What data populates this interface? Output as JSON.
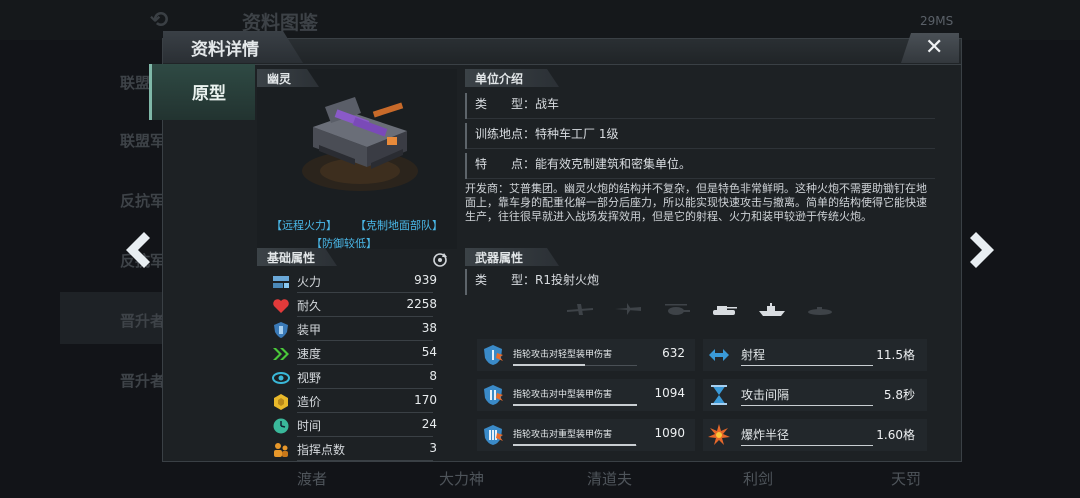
{
  "background": {
    "title": "资料图鉴",
    "status": "29MS",
    "sidebar": [
      "联盟",
      "联盟军",
      "反抗军",
      "反抗军",
      "晋升者",
      "晋升者"
    ],
    "bottom_tabs": [
      "渡者",
      "大力神",
      "清道夫",
      "利剑",
      "天罚"
    ]
  },
  "modal": {
    "title": "资料详情",
    "close_label": "✕",
    "left_tab": "原型"
  },
  "unit": {
    "name": "幽灵",
    "tags": [
      "【远程火力】",
      "【克制地面部队】",
      "【防御较低】"
    ]
  },
  "base_stats": {
    "heading": "基础属性",
    "rows": [
      {
        "label": "火力",
        "value": "939",
        "icon": "firepower-icon"
      },
      {
        "label": "耐久",
        "value": "2258",
        "icon": "heart-icon"
      },
      {
        "label": "装甲",
        "value": "38",
        "icon": "shield-icon"
      },
      {
        "label": "速度",
        "value": "54",
        "icon": "speed-icon"
      },
      {
        "label": "视野",
        "value": "8",
        "icon": "eye-icon"
      },
      {
        "label": "造价",
        "value": "170",
        "icon": "cost-icon"
      },
      {
        "label": "时间",
        "value": "24",
        "icon": "clock-icon"
      },
      {
        "label": "指挥点数",
        "value": "3",
        "icon": "command-icon"
      }
    ]
  },
  "unit_intro": {
    "heading": "单位介绍",
    "type_line": "类　　型：战车",
    "location_line": "训练地点：特种车工厂 1级",
    "feature_line": "特　　点：能有效克制建筑和密集单位。",
    "description": "开发商：艾普集团。幽灵火炮的结构并不复杂，但是特色非常鲜明。这种火炮不需要助锄钉在地面上，靠车身的配重化解一部分后座力，所以能实现快速攻击与撤离。简单的结构使得它能快速生产，往往很早就进入战场发挥效用，但是它的射程、火力和装甲较逊于传统火炮。"
  },
  "weapon": {
    "heading": "武器属性",
    "type_line": "类　　型：R1投射火炮",
    "targets": [
      "aircraft-icon",
      "jet-icon",
      "helicopter-icon",
      "tank-icon",
      "ship-icon",
      "submarine-icon"
    ],
    "damage": [
      {
        "label": "指轮攻击对轻型装甲伤害",
        "value": "632",
        "fill": 0.58
      },
      {
        "label": "指轮攻击对中型装甲伤害",
        "value": "1094",
        "fill": 1.0
      },
      {
        "label": "指轮攻击对重型装甲伤害",
        "value": "1090",
        "fill": 0.99
      }
    ],
    "props": [
      {
        "label": "射程",
        "value": "11.5格",
        "icon": "range-icon"
      },
      {
        "label": "攻击间隔",
        "value": "5.8秒",
        "icon": "hourglass-icon"
      },
      {
        "label": "爆炸半径",
        "value": "1.60格",
        "icon": "explosion-icon"
      }
    ]
  }
}
